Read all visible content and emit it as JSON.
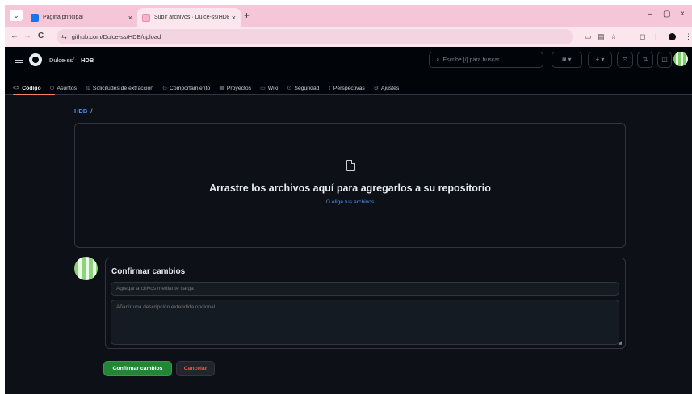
{
  "browser": {
    "tabs": [
      {
        "title": "Página principal",
        "favicon_color": "#1a73e8",
        "active": false
      },
      {
        "title": "Subir archivos · Dulce-ss/HDB",
        "favicon_color": "#f8b4c8",
        "active": true
      }
    ],
    "new_tab": "+",
    "close_glyph": "×",
    "back": "←",
    "forward": "→",
    "reload": "C",
    "url": "github.com/Dulce-ss/HDB/upload",
    "window_controls": {
      "minimize": "–",
      "maximize": "▢",
      "close": "×"
    }
  },
  "github": {
    "owner": "Dulce-ss",
    "separator": "/",
    "repo": "HDB",
    "search_placeholder": "Escribe [/] para buscar",
    "nav": [
      {
        "label": "Código",
        "icon": "code-icon",
        "glyph": "<>",
        "active": true
      },
      {
        "label": "Asuntos",
        "icon": "issue-icon",
        "glyph": "⊙",
        "active": false
      },
      {
        "label": "Solicitudes de extracción",
        "icon": "pull-request-icon",
        "glyph": "⇅",
        "active": false
      },
      {
        "label": "Comportamiento",
        "icon": "actions-icon",
        "glyph": "⊙",
        "active": false
      },
      {
        "label": "Proyectos",
        "icon": "projects-icon",
        "glyph": "▦",
        "active": false
      },
      {
        "label": "Wiki",
        "icon": "wiki-icon",
        "glyph": "▭",
        "active": false
      },
      {
        "label": "Seguridad",
        "icon": "shield-icon",
        "glyph": "⊙",
        "active": false
      },
      {
        "label": "Perspectivas",
        "icon": "graph-icon",
        "glyph": "⌇",
        "active": false
      },
      {
        "label": "Ajustes",
        "icon": "gear-icon",
        "glyph": "⚙",
        "active": false
      }
    ],
    "accent_color": "#f78166"
  },
  "upload": {
    "breadcrumb_repo": "HDB",
    "breadcrumb_slash": "/",
    "drop_title": "Arrastre los archivos aquí para agregarlos a su repositorio",
    "drop_sub_prefix": "O",
    "drop_sub_link": "elige tus archivos"
  },
  "commit": {
    "title": "Confirmar cambios",
    "summary_placeholder": "Agregar archivos mediante carga",
    "description_placeholder": "Añadir una descripción extendida opcional...",
    "confirm_label": "Confirmar cambios",
    "cancel_label": "Cancelar",
    "confirm_color": "#238636",
    "cancel_color": "#f85149"
  }
}
